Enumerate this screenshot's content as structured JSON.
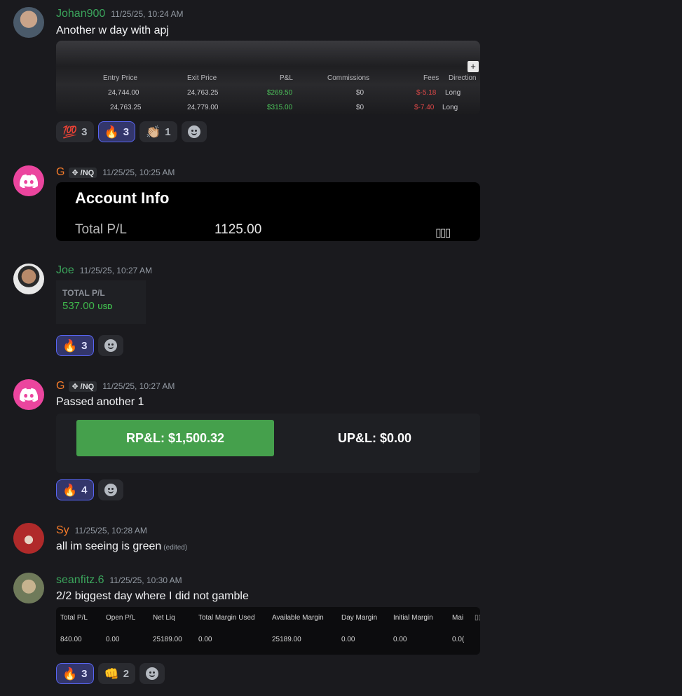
{
  "messages": [
    {
      "username": "Johan900",
      "timestamp": "11/25/25, 10:24 AM",
      "text": "Another w day with apj",
      "color": "#3ba55c",
      "trades": {
        "headers": [
          "Entry Price",
          "Exit Price",
          "P&L",
          "Commissions",
          "Fees",
          "Direction"
        ],
        "rows": [
          [
            "24,744.00",
            "24,763.25",
            "$269.50",
            "$0",
            "$-5.18",
            "Long"
          ],
          [
            "24,763.25",
            "24,779.00",
            "$315.00",
            "$0",
            "$-7.40",
            "Long"
          ]
        ],
        "plus_label": "+"
      },
      "reactions": [
        {
          "emoji": "💯",
          "count": "3",
          "me": false
        },
        {
          "emoji": "🔥",
          "count": "3",
          "me": true
        },
        {
          "emoji": "👏🏼",
          "count": "1",
          "me": false
        }
      ]
    },
    {
      "username": "G",
      "tag": "/NQ",
      "timestamp": "11/25/25, 10:25 AM",
      "color": "#f47b2a",
      "account_info": {
        "title": "Account Info",
        "label": "Total P/L",
        "value": "1125.00",
        "icon": "▯▯▯"
      }
    },
    {
      "username": "Joe",
      "timestamp": "11/25/25, 10:27 AM",
      "color": "#3ba55c",
      "total_pl": {
        "label": "TOTAL P/L",
        "value": "537.00",
        "currency": "USD"
      },
      "reactions": [
        {
          "emoji": "🔥",
          "count": "3",
          "me": true
        }
      ]
    },
    {
      "username": "G",
      "tag": "/NQ",
      "timestamp": "11/25/25, 10:27 AM",
      "text": "Passed another 1",
      "color": "#f47b2a",
      "pnl": {
        "rpl": "RP&L: $1,500.32",
        "upl": "UP&L: $0.00"
      },
      "reactions": [
        {
          "emoji": "🔥",
          "count": "4",
          "me": true
        }
      ]
    },
    {
      "username": "Sy",
      "timestamp": "11/25/25, 10:28 AM",
      "text": "all im seeing is green",
      "edited": "(edited)",
      "color": "#f47b2a"
    },
    {
      "username": "seanfitz.6",
      "timestamp": "11/25/25, 10:30 AM",
      "text": "2/2 biggest day where I did not gamble",
      "color": "#3ba55c",
      "margin": {
        "headers": [
          "Total P/L",
          "Open P/L",
          "Net Liq",
          "Total Margin Used",
          "Available Margin",
          "Day Margin",
          "Initial Margin",
          "Mai"
        ],
        "values": [
          "840.00",
          "0.00",
          "25189.00",
          "0.00",
          "25189.00",
          "0.00",
          "0.00",
          "0.0("
        ]
      },
      "reactions": [
        {
          "emoji": "🔥",
          "count": "3",
          "me": true
        },
        {
          "emoji": "👊",
          "count": "2",
          "me": false
        }
      ]
    }
  ]
}
